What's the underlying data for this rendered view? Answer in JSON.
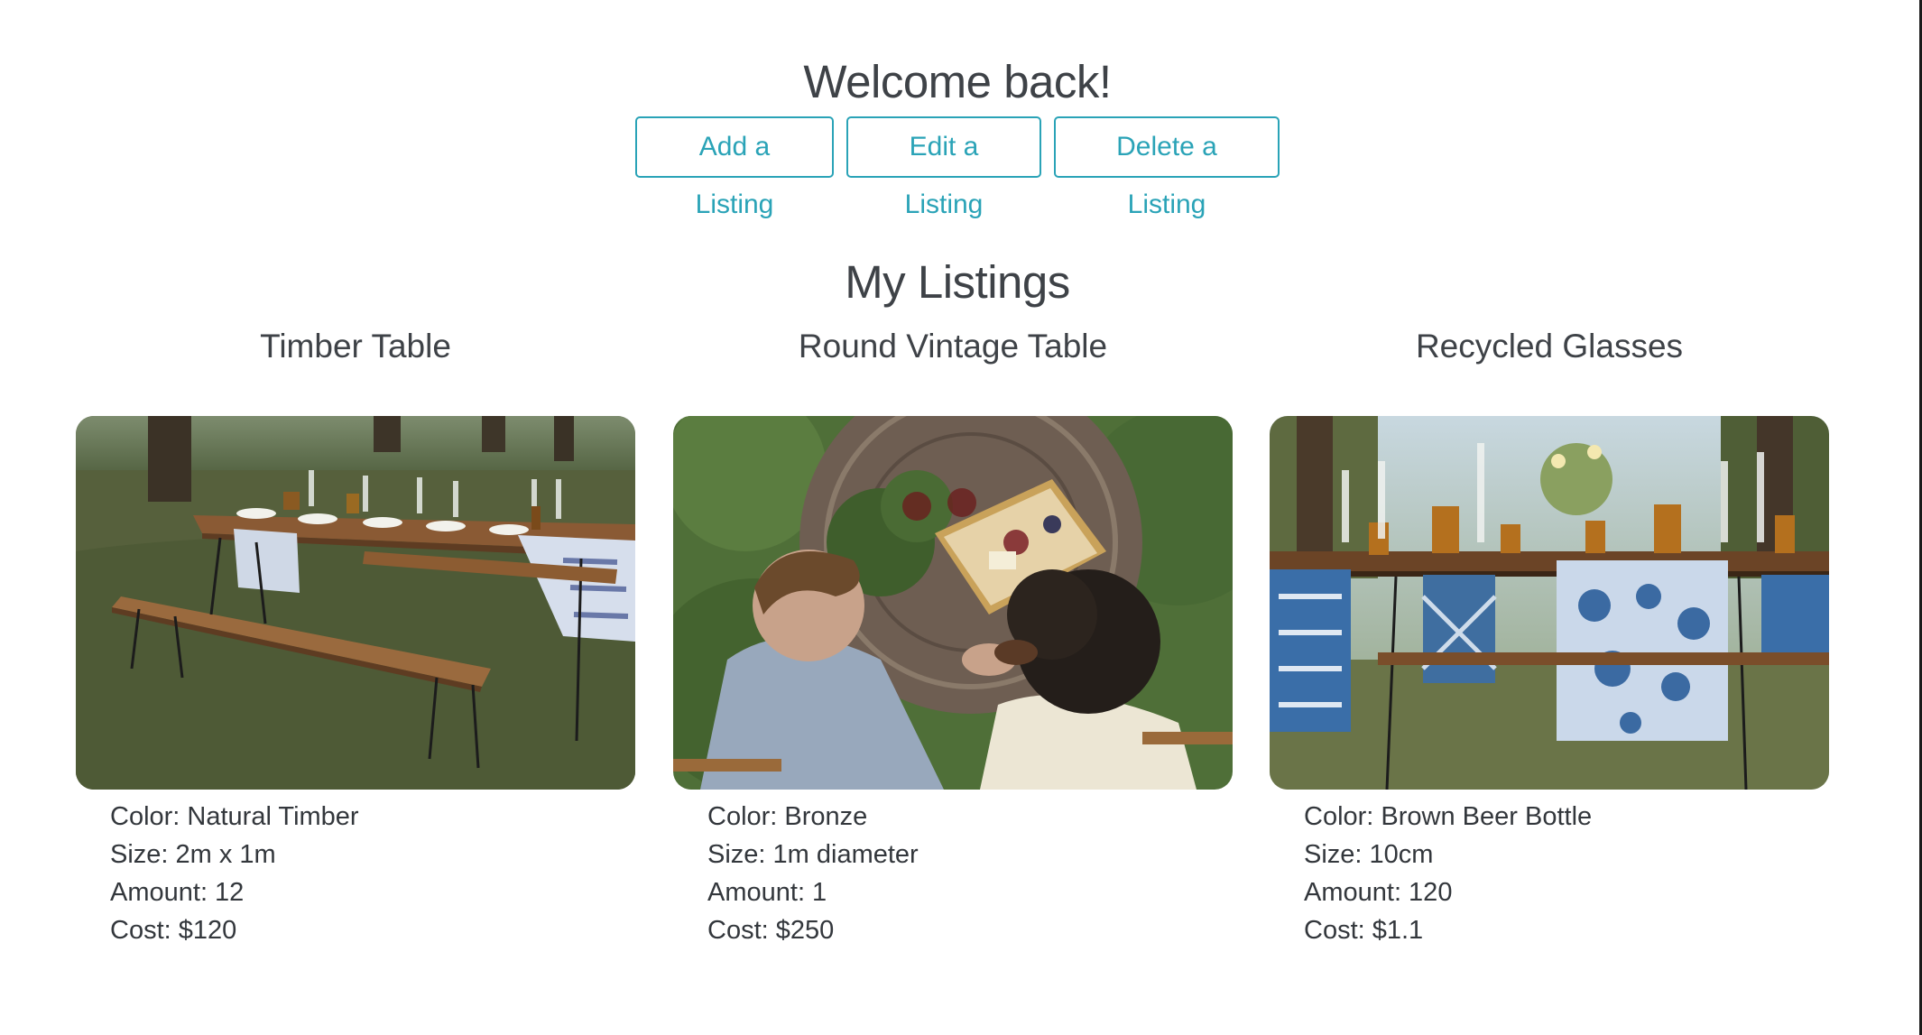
{
  "header": {
    "welcome": "Welcome back!",
    "section_title": "My Listings"
  },
  "actions": {
    "add_label": "Add a Listing",
    "edit_label": "Edit a Listing",
    "delete_label": "Delete a Listing"
  },
  "listings": [
    {
      "title": "Timber Table",
      "image_icon": "outdoor-timber-table-photo",
      "color": "Color: Natural Timber",
      "size": "Size: 2m x 1m",
      "amount": "Amount: 12",
      "cost": "Cost: $120"
    },
    {
      "title": "Round Vintage Table",
      "image_icon": "round-vintage-table-photo",
      "color": "Color: Bronze",
      "size": "Size: 1m diameter",
      "amount": "Amount: 1",
      "cost": "Cost: $250"
    },
    {
      "title": "Recycled Glasses",
      "image_icon": "recycled-glasses-photo",
      "color": "Color: Brown Beer Bottle",
      "size": "Size: 10cm",
      "amount": "Amount: 120",
      "cost": "Cost: $1.1"
    }
  ],
  "colors": {
    "accent": "#2aa3b7",
    "heading": "#3e4247",
    "text": "#33373c"
  }
}
